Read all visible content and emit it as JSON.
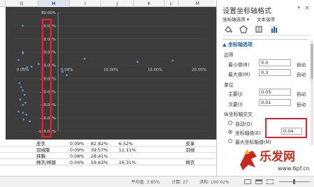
{
  "columns": [
    "G",
    "H",
    "I",
    "J",
    "K",
    "L",
    "M"
  ],
  "chart_data": {
    "type": "scatter",
    "xticks": [
      "0.00%",
      "5.00%",
      "10.00%",
      "15.00%",
      "20.00%"
    ],
    "yticks": [
      "80.00%",
      "60.00%",
      "40.00%",
      "20.00%",
      "0.00%",
      "-20.00%",
      "-40.00%",
      "-60.00%",
      "-80.00%",
      "-100.00%"
    ],
    "xlim": [
      -0.01,
      0.21
    ],
    "ylim": [
      -1.0,
      0.8
    ],
    "points": [
      [
        0.0,
        0.6
      ],
      [
        0.0,
        0.2
      ],
      [
        0.0,
        0.18
      ],
      [
        -0.005,
        0.08
      ],
      [
        0.0,
        -0.05
      ],
      [
        0.005,
        -0.03
      ],
      [
        0.01,
        -0.02
      ],
      [
        0.018,
        0.02
      ],
      [
        0.022,
        -0.04
      ],
      [
        0.045,
        -0.1
      ],
      [
        0.05,
        -0.15
      ],
      [
        0.07,
        0.1
      ],
      [
        0.13,
        0.05
      ],
      [
        0.17,
        0.07
      ],
      [
        -0.004,
        -0.27
      ],
      [
        -0.002,
        -0.33
      ],
      [
        0.0,
        -0.38
      ],
      [
        0.002,
        -0.45
      ],
      [
        -0.003,
        -0.52
      ],
      [
        0.0,
        -0.6
      ],
      [
        0.003,
        -0.57
      ],
      [
        -0.005,
        -0.7
      ],
      [
        0.0,
        -0.72
      ],
      [
        0.004,
        -0.75
      ],
      [
        0.001,
        -0.82
      ],
      [
        0.008,
        -0.85
      ]
    ]
  },
  "grid": {
    "rows": [
      {
        "name": "皮衣",
        "i": "0.09%",
        "j": "82.82%",
        "k": "6.52%",
        "m": "皮革"
      },
      {
        "name": "羽绒服",
        "i": "0.09%",
        "j": "39.57%",
        "k": "11.11%",
        "m": "羽绒"
      },
      {
        "name": "抹胸",
        "i": "0.08%",
        "j": "28.41%",
        "k": "",
        "m": ""
      },
      {
        "name": "棉衣/棉服",
        "i": "0.04%",
        "j": "59.63%",
        "k": "16.31%",
        "m": "棉衣"
      }
    ]
  },
  "panel": {
    "title": "设置坐标轴格式",
    "close": "×",
    "drop": "▾",
    "subtitle": "坐标轴选项 ▾",
    "subtitle2": "文本选项",
    "section": "▲ 坐标轴选项",
    "bounds_label": "边界",
    "min_label": "最小值(B)",
    "min_value": "0.0",
    "max_label": "最大值(M)",
    "max_value": "0.3",
    "auto": "自动",
    "units_label": "单位",
    "major_label": "主要(J)",
    "major_value": "0.05",
    "minor_label": "次要(I)",
    "minor_value": "0.01",
    "cross_label": "纵坐标轴交叉",
    "radio_auto": "自动(O)",
    "radio_value": "坐标轴值(E)",
    "cross_value": "0.04",
    "radio_max": "最大坐标轴值(M)"
  },
  "status": {
    "avg": "平均值: 3.85%",
    "count": "计数: 27",
    "sum": "求和: 100.02%"
  },
  "watermark": {
    "text": "乐发网",
    "url": "www.6pf.cn"
  }
}
